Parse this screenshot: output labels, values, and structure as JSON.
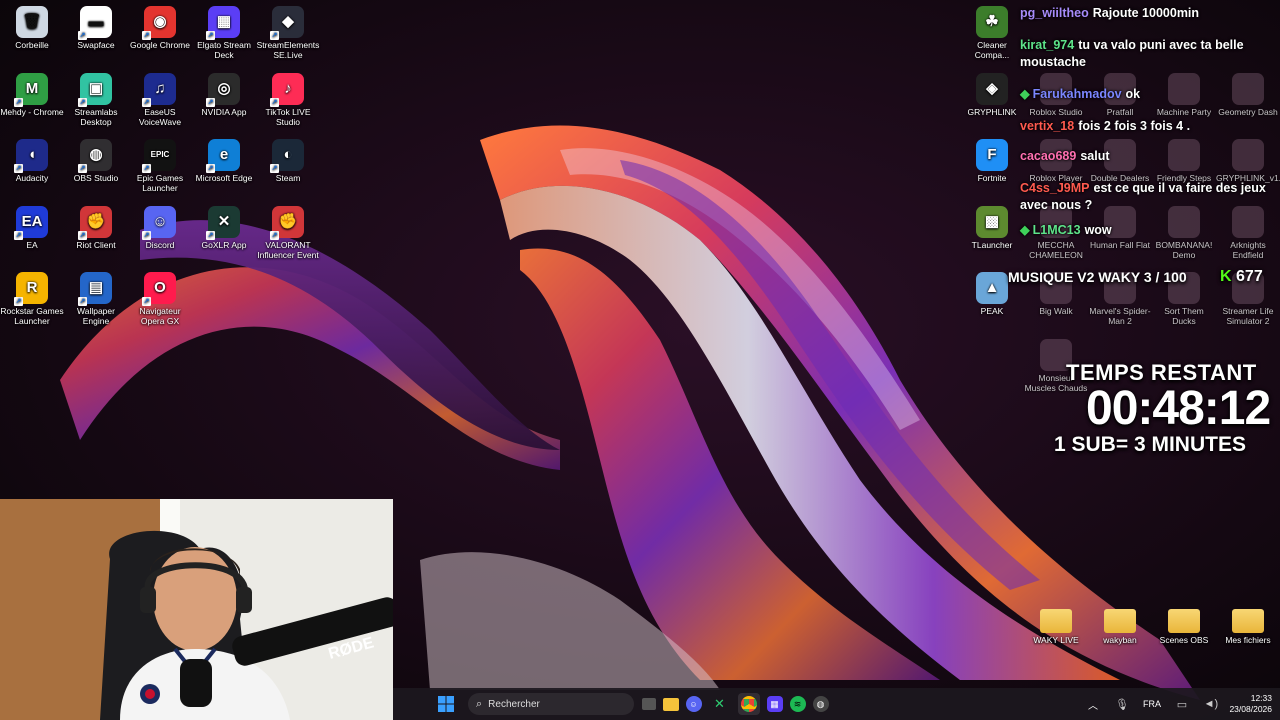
{
  "desktop_icons": [
    {
      "label": "Corbeille",
      "icon": "recycle-bin-icon",
      "glyph": "🗑",
      "bg": "#cfd8e3"
    },
    {
      "label": "Swapface",
      "icon": "mask-icon",
      "glyph": "▬",
      "bg": "#ffffff"
    },
    {
      "label": "Google Chrome",
      "icon": "chrome-icon",
      "glyph": "◉",
      "bg": "#e3342f"
    },
    {
      "label": "Elgato Stream Deck",
      "icon": "stream-deck-icon",
      "glyph": "▦",
      "bg": "#5b3ef5"
    },
    {
      "label": "StreamElements SE.Live",
      "icon": "streamelements-icon",
      "glyph": "◆",
      "bg": "#2a2d3a"
    },
    {
      "label": "Mehdy - Chrome",
      "icon": "chrome-profile-icon",
      "glyph": "M",
      "bg": "#2f9e44"
    },
    {
      "label": "Streamlabs Desktop",
      "icon": "streamlabs-icon",
      "glyph": "▣",
      "bg": "#31c3a2"
    },
    {
      "label": "EaseUS VoiceWave",
      "icon": "voicewave-icon",
      "glyph": "♫",
      "bg": "#1d2b8f"
    },
    {
      "label": "NVIDIA App",
      "icon": "nvidia-icon",
      "glyph": "◎",
      "bg": "#2b2b2b"
    },
    {
      "label": "TikTok LIVE Studio",
      "icon": "tiktok-icon",
      "glyph": "♪",
      "bg": "#fe2c55"
    },
    {
      "label": "Audacity",
      "icon": "audacity-icon",
      "glyph": "◖",
      "bg": "#1e2a8a"
    },
    {
      "label": "OBS Studio",
      "icon": "obs-icon",
      "glyph": "◍",
      "bg": "#302e31"
    },
    {
      "label": "Epic Games Launcher",
      "icon": "epic-games-icon",
      "glyph": "EPIC",
      "bg": "#121212"
    },
    {
      "label": "Microsoft Edge",
      "icon": "edge-icon",
      "glyph": "e",
      "bg": "#0f7fd6"
    },
    {
      "label": "Steam",
      "icon": "steam-icon",
      "glyph": "◐",
      "bg": "#1b2838"
    },
    {
      "label": "EA",
      "icon": "ea-icon",
      "glyph": "EA",
      "bg": "#1f3bd8"
    },
    {
      "label": "Riot Client",
      "icon": "riot-icon",
      "glyph": "✊",
      "bg": "#d13639"
    },
    {
      "label": "Discord",
      "icon": "discord-icon",
      "glyph": "☺",
      "bg": "#5865f2"
    },
    {
      "label": "GoXLR App",
      "icon": "goxlr-icon",
      "glyph": "✕",
      "bg": "#1b3a33"
    },
    {
      "label": "VALORANT Influencer Event",
      "icon": "valorant-icon",
      "glyph": "✊",
      "bg": "#d13639"
    },
    {
      "label": "Rockstar Games Launcher",
      "icon": "rockstar-icon",
      "glyph": "R",
      "bg": "#f5b400"
    },
    {
      "label": "Wallpaper Engine",
      "icon": "wallpaper-engine-icon",
      "glyph": "▤",
      "bg": "#2466c9"
    },
    {
      "label": "Navigateur Opera GX",
      "icon": "opera-gx-icon",
      "glyph": "O",
      "bg": "#ff1b4d"
    }
  ],
  "right_icons": [
    {
      "label": "Cleaner Compa...",
      "icon": "cleaner-icon",
      "glyph": "☘",
      "bg": "#3c7d2b"
    },
    {
      "label": "GRYPHLINK",
      "icon": "gryphlink-icon",
      "glyph": "◈",
      "bg": "#222"
    },
    {
      "label": "Fortnite",
      "icon": "fortnite-icon",
      "glyph": "F",
      "bg": "#1f8ff5"
    },
    {
      "label": "TLauncher",
      "icon": "tlauncher-icon",
      "glyph": "▩",
      "bg": "#5d8a2f"
    },
    {
      "label": "PEAK",
      "icon": "peak-icon",
      "glyph": "▲",
      "bg": "#6aa6d8"
    }
  ],
  "ghost_icons": [
    {
      "label": "Roblox Studio"
    },
    {
      "label": "Pratfall"
    },
    {
      "label": "Machine Party"
    },
    {
      "label": "Geometry Dash"
    },
    {
      "label": "Roblox Player"
    },
    {
      "label": "Double Dealers"
    },
    {
      "label": "Friendly Steps"
    },
    {
      "label": "GRYPHLINK_v1..."
    },
    {
      "label": "MECCHA CHAMELEON"
    },
    {
      "label": "Human Fall Flat"
    },
    {
      "label": "BOMBANANA! Demo"
    },
    {
      "label": "Arknights Endfield"
    },
    {
      "label": "Big Walk"
    },
    {
      "label": "Marvel's Spider-Man 2"
    },
    {
      "label": "Sort Them Ducks"
    },
    {
      "label": "Streamer Life Simulator 2"
    },
    {
      "label": "Monsieur Muscles Chauds"
    }
  ],
  "folders": [
    {
      "label": "WAKY LIVE"
    },
    {
      "label": "wakyban"
    },
    {
      "label": "Scenes OBS"
    },
    {
      "label": "Mes fichiers"
    }
  ],
  "chat": [
    {
      "user": "pg_wiiltheo",
      "color": "#a78bfa",
      "message": "Rajoute 10000min",
      "badge": ""
    },
    {
      "user": "kirat_974",
      "color": "#5ee38a",
      "message": "tu va valo puni avec ta belle moustache",
      "badge": ""
    },
    {
      "user": "Farukahmadov",
      "color": "#7b86ff",
      "message": "ok",
      "badge": "◆"
    },
    {
      "user": "vertix_18",
      "color": "#ff5a4f",
      "message": "fois 2 fois 3 fois 4 .",
      "badge": ""
    },
    {
      "user": "cacao689",
      "color": "#ff6fb0",
      "message": "salut",
      "badge": ""
    },
    {
      "user": "C4ss_J9MP",
      "color": "#ff5a4f",
      "message": "est ce que il va faire des jeux avec nous ?",
      "badge": ""
    },
    {
      "user": "L1MC13",
      "color": "#5ee38a",
      "message": "wow",
      "badge": "◆"
    }
  ],
  "music": {
    "title": "MUSIQUE V2 WAKY 3 / 100",
    "kick_count": "677",
    "kick_label": "K"
  },
  "timer": {
    "heading": "TEMPS RESTANT",
    "time": "00:48:12",
    "rule": "1 SUB= 3 MINUTES"
  },
  "taskbar": {
    "search_placeholder": "Rechercher",
    "language": "FRA",
    "time": "12:33",
    "date": "23/08/2026"
  }
}
